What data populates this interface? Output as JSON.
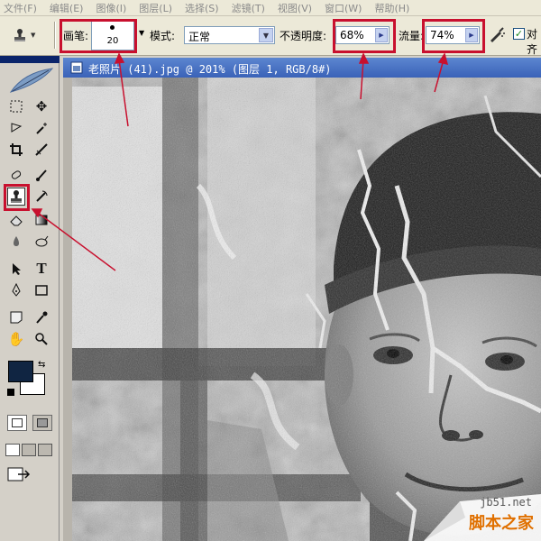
{
  "menubar": {
    "items": [
      "文件(F)",
      "编辑(E)",
      "图像(I)",
      "图层(L)",
      "选择(S)",
      "滤镜(T)",
      "视图(V)",
      "窗口(W)",
      "帮助(H)"
    ]
  },
  "options": {
    "brush_label": "画笔:",
    "brush_size": "20",
    "mode_label": "模式:",
    "mode_value": "正常",
    "opacity_label": "不透明度:",
    "opacity_value": "68%",
    "flow_label": "流量:",
    "flow_value": "74%",
    "align_label": "对齐",
    "align_checked": true
  },
  "toolbox": {
    "foreground_color": "#102542",
    "background_color": "#ffffff",
    "selected_tool": "clone-stamp-tool"
  },
  "document": {
    "title": "老照片 (41).jpg @ 201% (图层 1, RGB/8#)"
  },
  "watermark": {
    "site": "jb51.net",
    "text": "脚本之家"
  },
  "annotations": {
    "color": "#c8102e"
  }
}
